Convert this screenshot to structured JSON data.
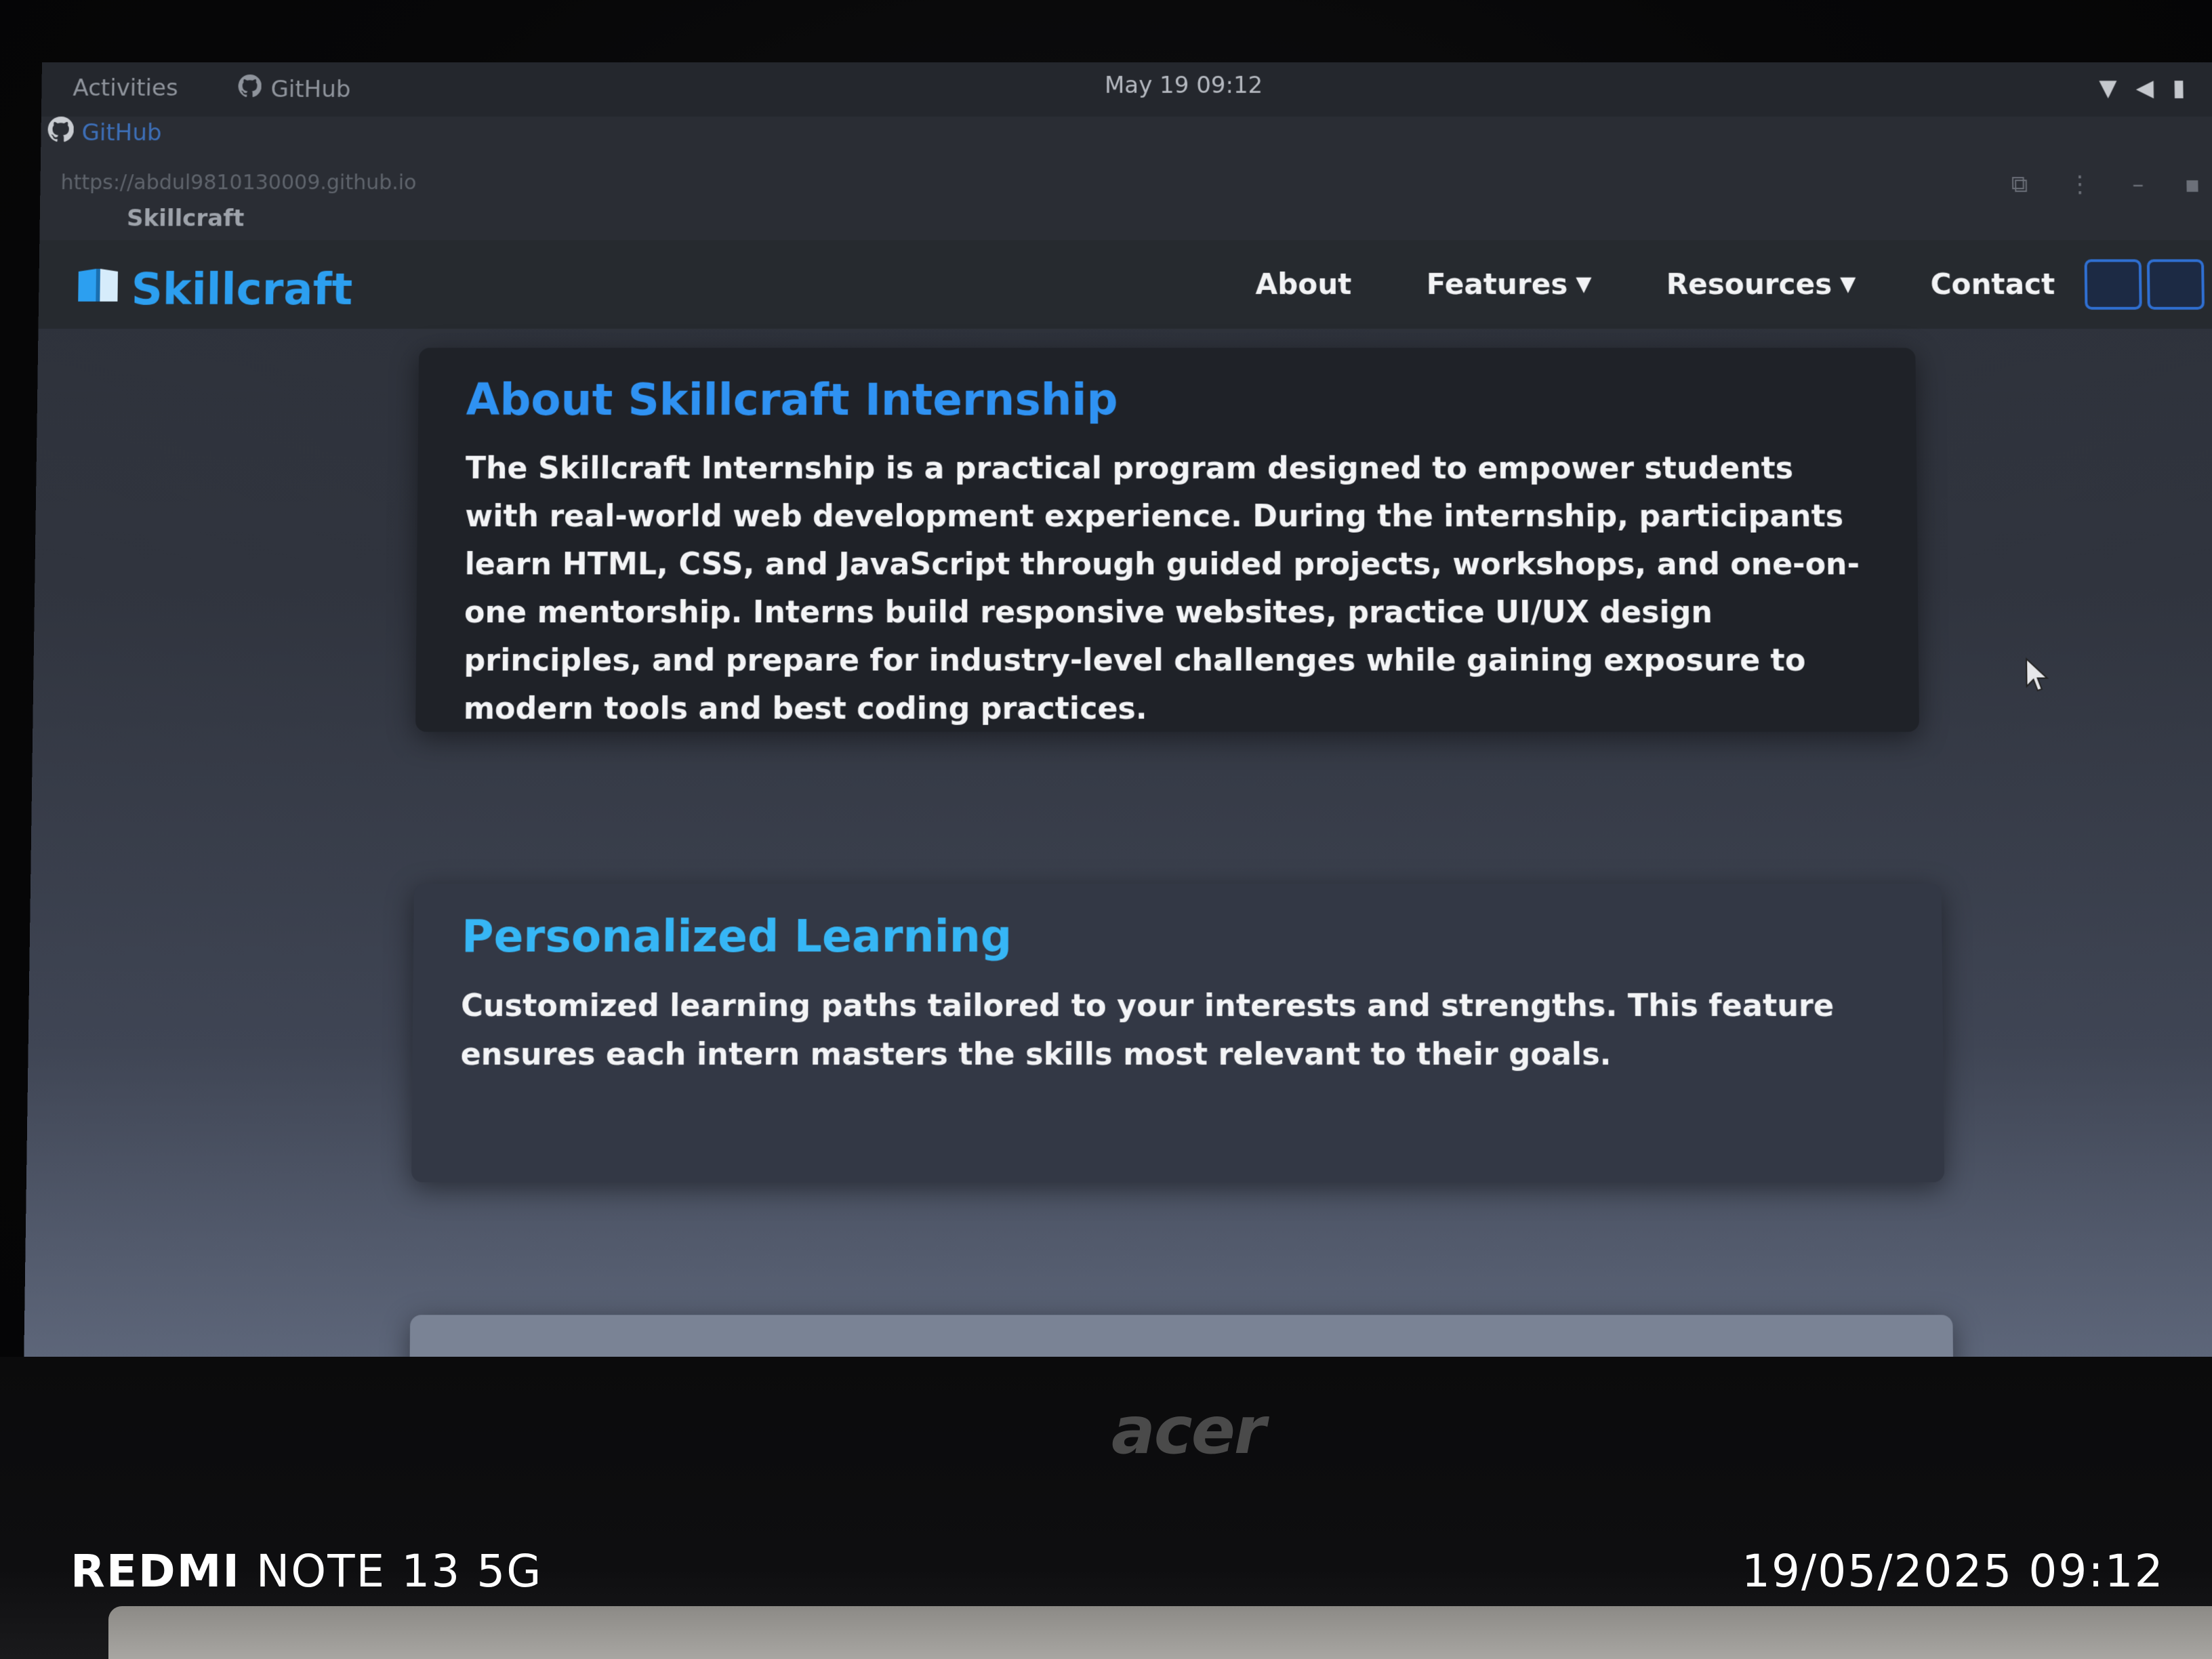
{
  "system_bar": {
    "activities": "Activities",
    "app_name": "GitHub",
    "clock": "May 19  09:12"
  },
  "browser": {
    "tab_title": "GitHub",
    "url": "https://abdul9810130009.github.io",
    "page_title": "Skillcraft"
  },
  "site": {
    "brand": "Skillcraft",
    "nav": {
      "about": "About",
      "features": "Features",
      "resources": "Resources",
      "contact": "Contact"
    }
  },
  "about_card": {
    "heading": "About Skillcraft Internship",
    "body": "The Skillcraft Internship is a practical program designed to empower students with real-world web development experience. During the internship, participants learn HTML, CSS, and JavaScript through guided projects, workshops, and one-on-one mentorship. Interns build responsive websites, practice UI/UX design principles, and prepare for industry-level challenges while gaining exposure to modern tools and best coding practices."
  },
  "feature_card": {
    "heading": "Personalized Learning",
    "body": "Customized learning paths tailored to your interests and strengths. This feature ensures each intern masters the skills most relevant to their goals."
  },
  "laptop": {
    "logo": "acer"
  },
  "watermark": {
    "brand_bold": "REDMI",
    "model": "NOTE 13 5G",
    "timestamp": "19/05/2025 09:12"
  },
  "icons": [
    "github-icon",
    "book-icon",
    "caret-down-icon",
    "wifi-icon",
    "volume-icon",
    "battery-icon",
    "cursor-icon"
  ],
  "colors": {
    "brand_blue": "#2c9ff0",
    "heading_blue": "#2f92f2",
    "heading_cyan": "#36b6f5",
    "navbar_bg": "#262a2f",
    "card_bg": "#1f2228"
  }
}
